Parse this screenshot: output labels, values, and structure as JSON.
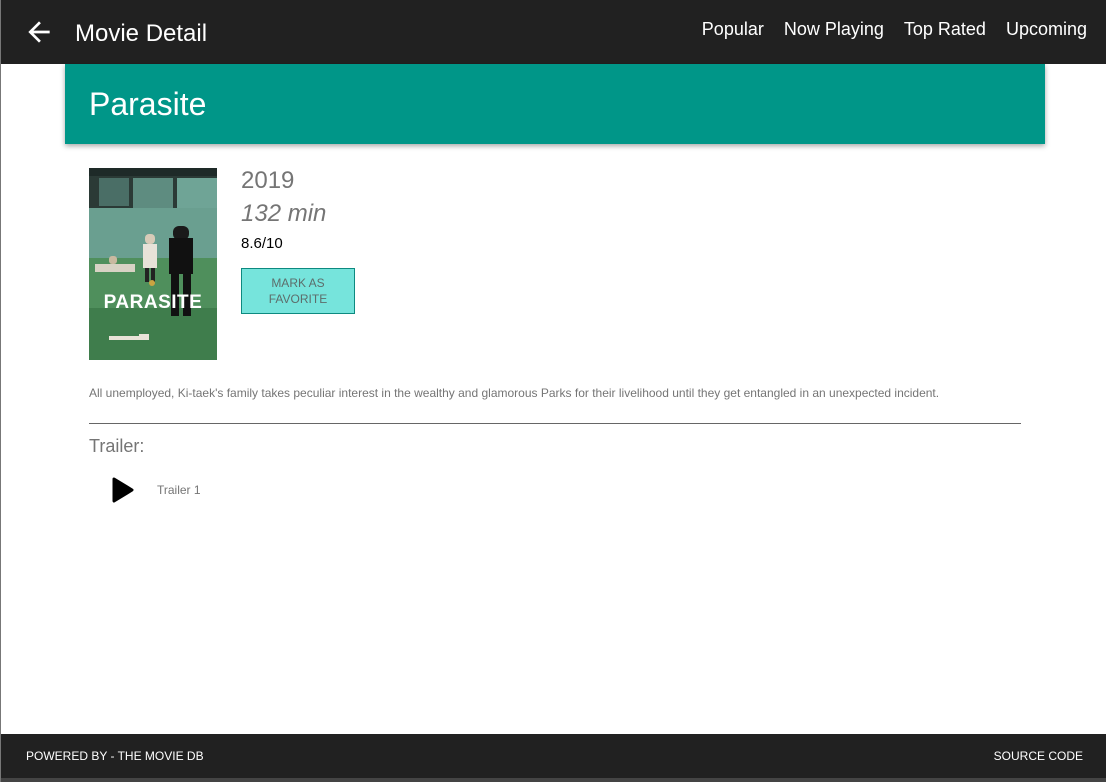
{
  "header": {
    "title": "Movie Detail",
    "back_icon": "arrow-left-icon",
    "nav": [
      {
        "label": "Popular"
      },
      {
        "label": "Now Playing"
      },
      {
        "label": "Top Rated"
      },
      {
        "label": "Upcoming"
      }
    ]
  },
  "movie": {
    "title": "Parasite",
    "year": "2019",
    "runtime": "132 min",
    "rating": "8.6/10",
    "poster_text": "PARASITE",
    "favorite_button": {
      "line1": "MARK AS",
      "line2": "FAVORITE"
    },
    "overview": "All unemployed, Ki-taek's family takes peculiar interest in the wealthy and glamorous Parks for their livelihood until they get entangled in an unexpected incident."
  },
  "trailers": {
    "heading": "Trailer:",
    "items": [
      {
        "label": "Trailer 1",
        "icon": "play-icon"
      }
    ]
  },
  "footer": {
    "powered_by": "POWERED BY - THE MOVIE DB",
    "source_code": "SOURCE CODE"
  },
  "colors": {
    "toolbar": "#212121",
    "accent": "#009688",
    "favorite_button": "#76e4dc",
    "secondary_text": "#757575"
  }
}
